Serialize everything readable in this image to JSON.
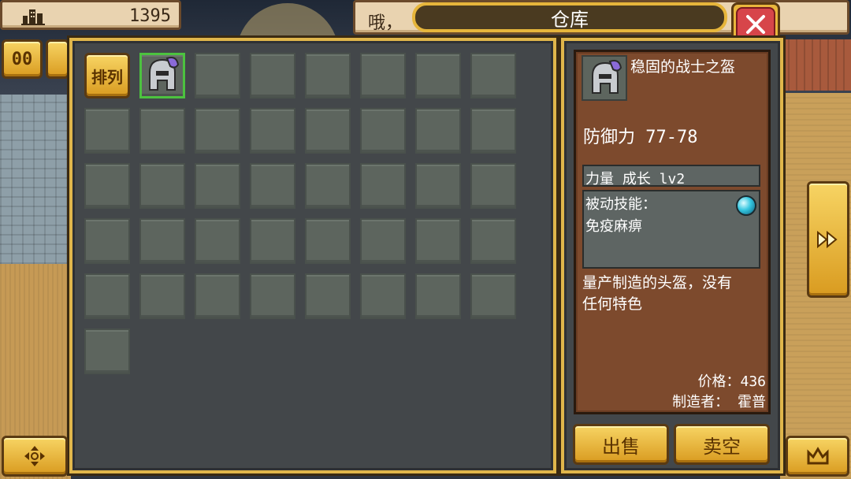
{
  "hud": {
    "gold_icon": "building-icon",
    "gold_value": "1395",
    "message_text": "哦，",
    "pause_label": "00"
  },
  "warehouse": {
    "title": "仓库",
    "close_icon": "close-x-icon",
    "sort_label": "排列",
    "item_icon": "helmet-icon"
  },
  "item_detail": {
    "name": "稳固的战士之盔",
    "defense_label": "防御力",
    "defense_value": "77-78",
    "growth_text": "力量 成长 lv2",
    "passive_label": "被动技能：",
    "passive_skill": "免疫麻痹",
    "gem_icon": "blue-orb-icon",
    "description_line1": "量产制造的头盔，没有",
    "description_line2": "任何特色",
    "price_text": "价格：436",
    "maker_text": "制造者： 霍普"
  },
  "actions": {
    "sell_label": "出售",
    "sell_all_label": "卖空"
  },
  "side_buttons": {
    "move_icon": "dpad-icon",
    "fast_forward_icon": "fast-forward-icon",
    "crown_icon": "crown-icon"
  }
}
